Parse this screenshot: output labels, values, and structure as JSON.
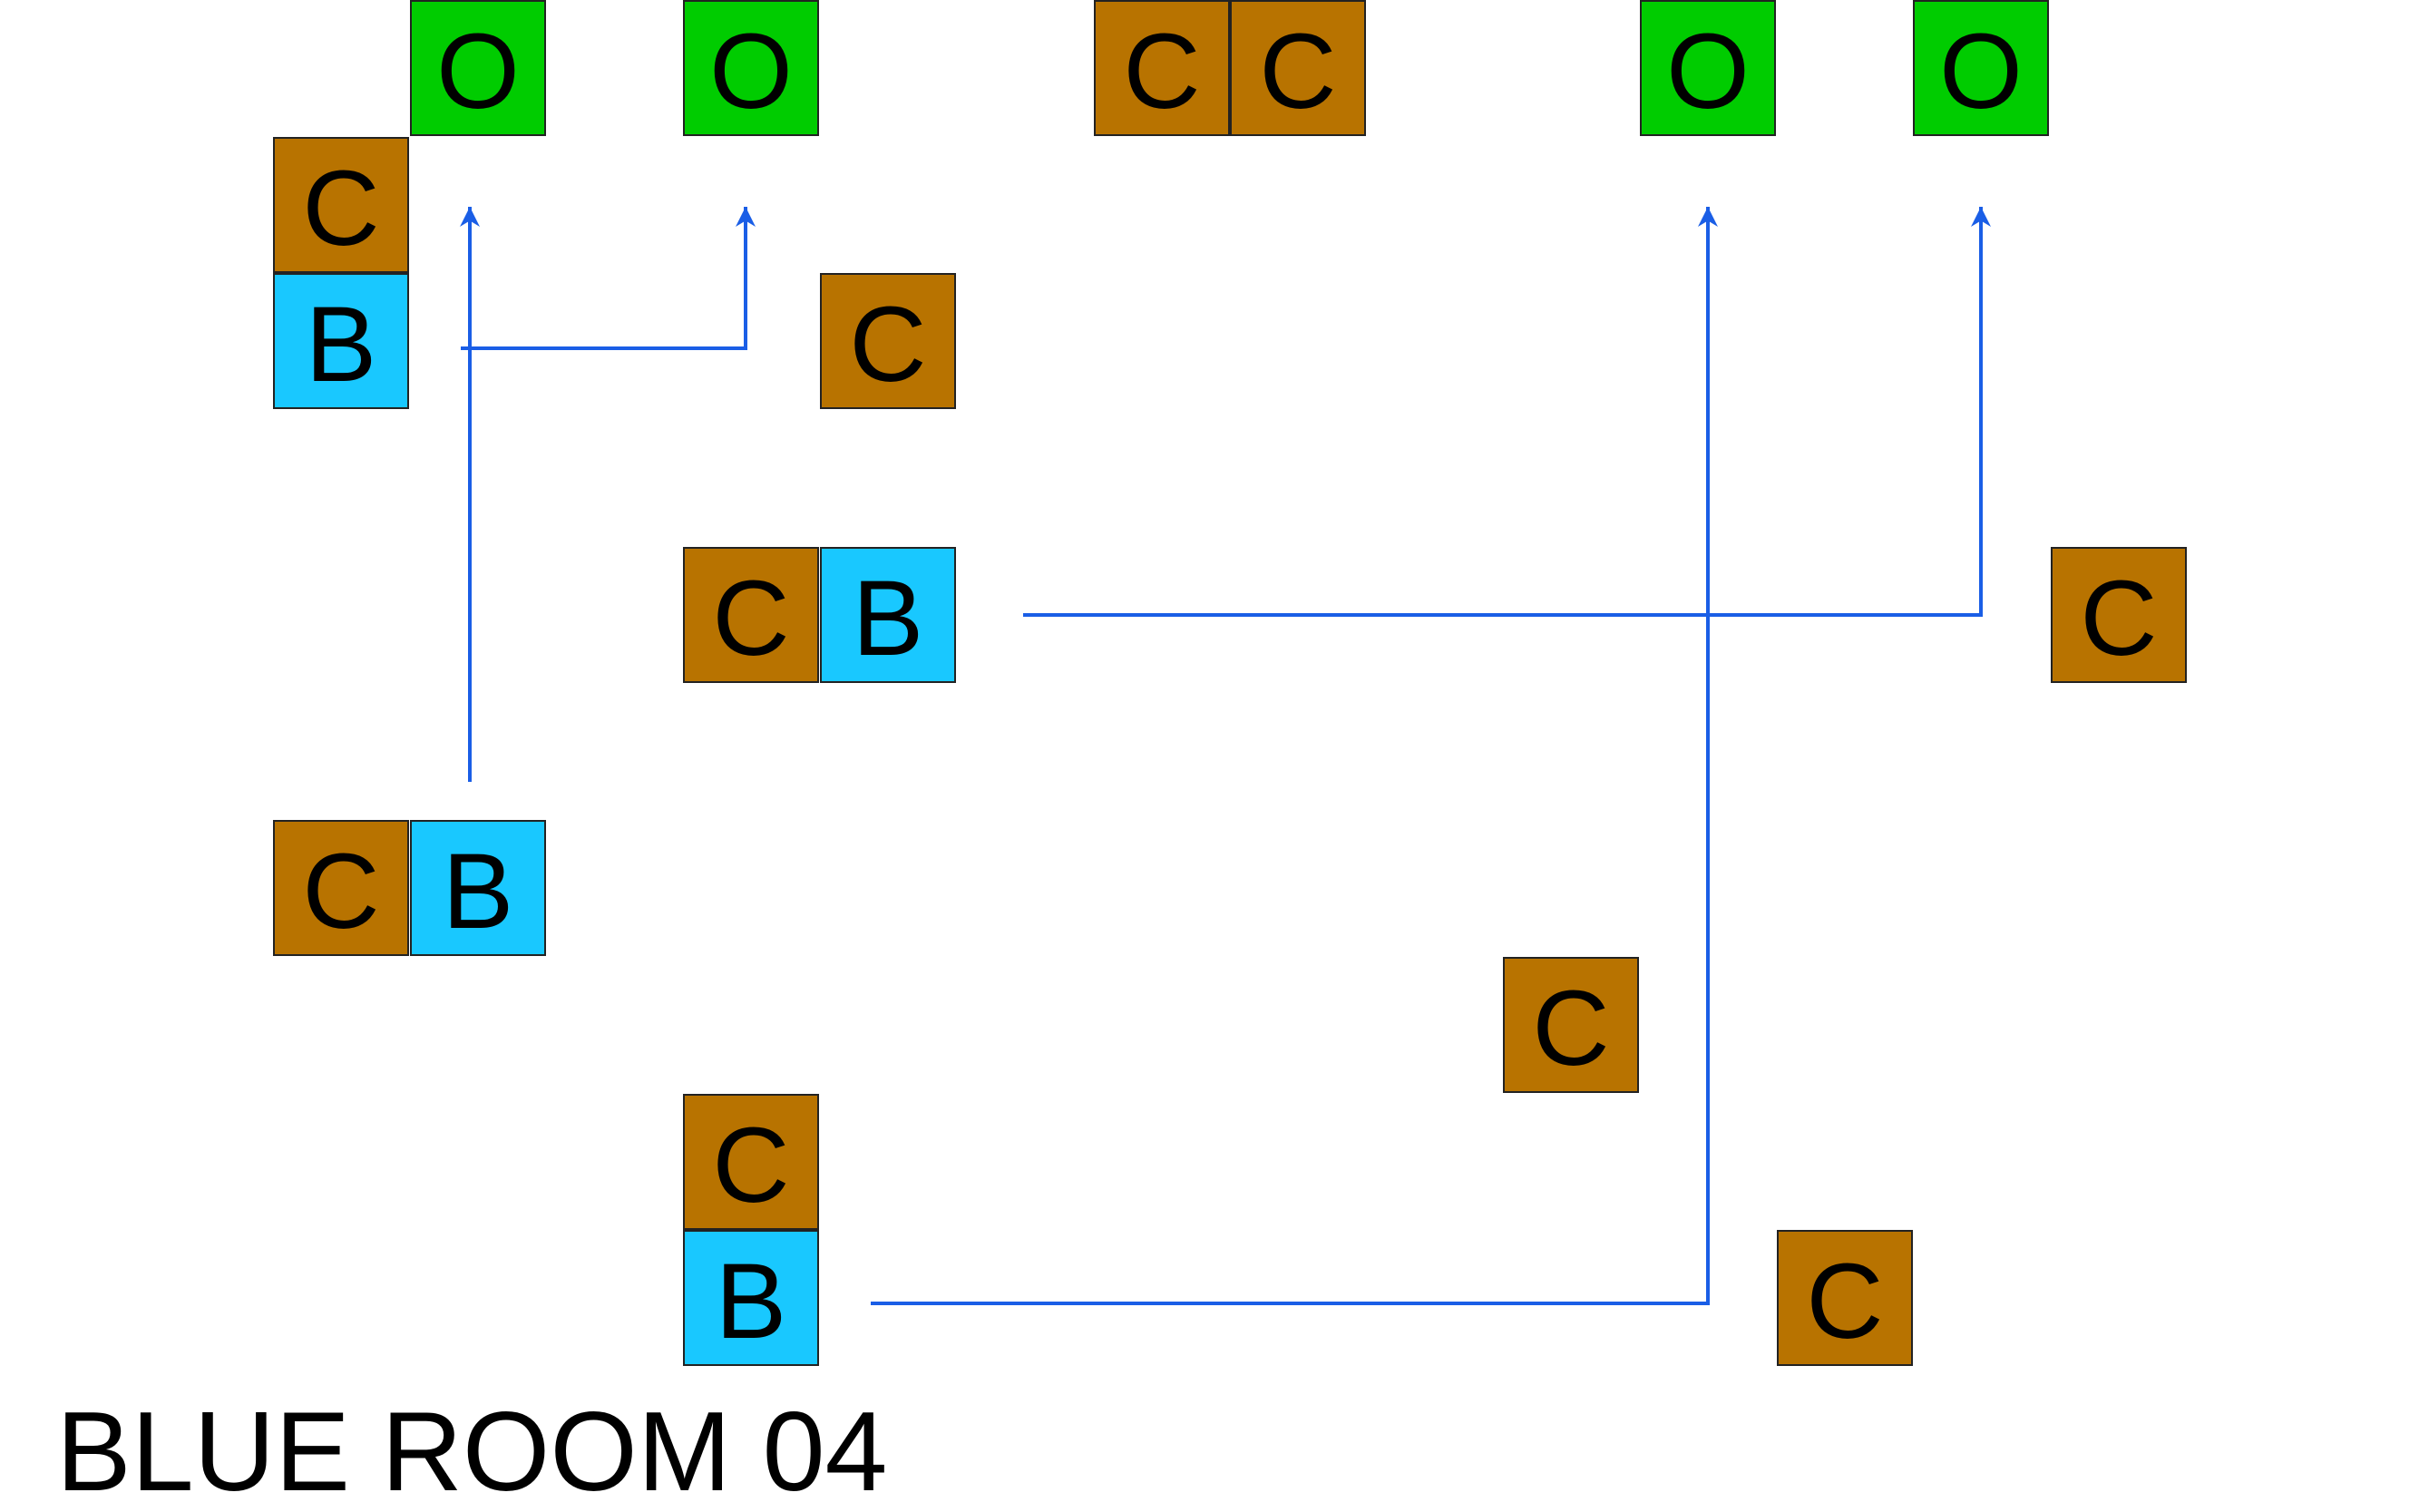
{
  "title": "BLUE ROOM 04",
  "colors": {
    "crate": "#B87300",
    "blue_block": "#19C8FF",
    "goal": "#00CC00",
    "arrow": "#1A5EE6",
    "border": "#222222",
    "text": "#000000"
  },
  "tiles": [
    {
      "id": "goal-1",
      "kind": "goal",
      "label": "O"
    },
    {
      "id": "goal-2",
      "kind": "goal",
      "label": "O"
    },
    {
      "id": "crate-top-1",
      "kind": "crate",
      "label": "C"
    },
    {
      "id": "crate-top-2",
      "kind": "crate",
      "label": "C"
    },
    {
      "id": "goal-3",
      "kind": "goal",
      "label": "O"
    },
    {
      "id": "goal-4",
      "kind": "goal",
      "label": "O"
    },
    {
      "id": "crate-1",
      "kind": "crate",
      "label": "C"
    },
    {
      "id": "blue-1",
      "kind": "blue",
      "label": "B"
    },
    {
      "id": "crate-2",
      "kind": "crate",
      "label": "C"
    },
    {
      "id": "crate-3",
      "kind": "crate",
      "label": "C"
    },
    {
      "id": "blue-2",
      "kind": "blue",
      "label": "B"
    },
    {
      "id": "crate-4",
      "kind": "crate",
      "label": "C"
    },
    {
      "id": "crate-5",
      "kind": "crate",
      "label": "C"
    },
    {
      "id": "blue-3",
      "kind": "blue",
      "label": "B"
    },
    {
      "id": "crate-6",
      "kind": "crate",
      "label": "C"
    },
    {
      "id": "crate-7",
      "kind": "crate",
      "label": "C"
    },
    {
      "id": "blue-4",
      "kind": "blue",
      "label": "B"
    },
    {
      "id": "crate-8",
      "kind": "crate",
      "label": "C"
    }
  ],
  "paths": [
    {
      "id": "path-blue-1-to-goal-2"
    },
    {
      "id": "path-blue-3-to-goal-1"
    },
    {
      "id": "path-blue-2-to-goal-4"
    },
    {
      "id": "path-blue-4-to-goal-3"
    }
  ]
}
